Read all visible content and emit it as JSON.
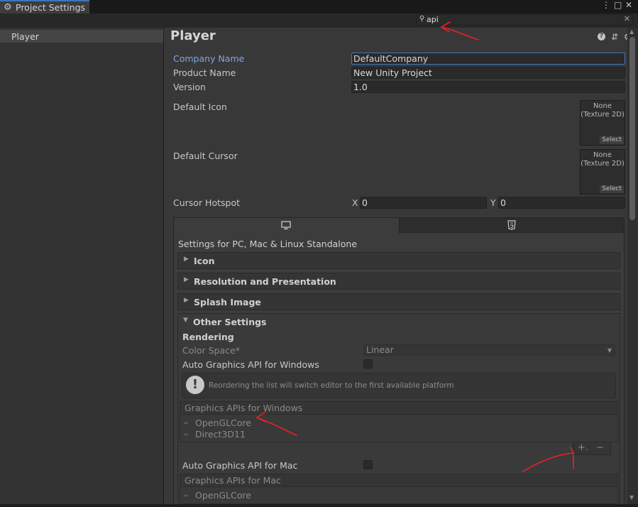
{
  "window": {
    "tab_title": "Project Settings",
    "menu_glyph": "⋮",
    "maximize_glyph": "□",
    "close_glyph": "✕"
  },
  "search": {
    "value": "api",
    "clear_glyph": "✕"
  },
  "sidebar": {
    "items": [
      {
        "label": "Player"
      }
    ]
  },
  "main": {
    "title": "Player",
    "help_glyph": "?",
    "preset_glyph": "⇵",
    "settings_glyph": "⚙"
  },
  "fields": {
    "company_name": {
      "label": "Company Name",
      "value": "DefaultCompany"
    },
    "product_name": {
      "label": "Product Name",
      "value": "New Unity Project"
    },
    "version": {
      "label": "Version",
      "value": "1.0"
    },
    "default_icon": {
      "label": "Default Icon",
      "slot_text": "None\n(Texture 2D)",
      "select_label": "Select"
    },
    "default_cursor": {
      "label": "Default Cursor",
      "slot_text": "None\n(Texture 2D)",
      "select_label": "Select"
    },
    "cursor_hotspot": {
      "label": "Cursor Hotspot",
      "x_label": "X",
      "x_value": "0",
      "y_label": "Y",
      "y_value": "0"
    }
  },
  "platform": {
    "settings_for": "Settings for PC, Mac & Linux Standalone",
    "foldouts": [
      {
        "label": "Icon",
        "arrow": "▶"
      },
      {
        "label": "Resolution and Presentation",
        "arrow": "▶"
      },
      {
        "label": "Splash Image",
        "arrow": "▶"
      },
      {
        "label": "Other Settings",
        "arrow": "▼"
      }
    ],
    "other_settings": {
      "rendering_header": "Rendering",
      "color_space": {
        "label": "Color Space*",
        "value": "Linear",
        "arrow": "▼"
      },
      "auto_graphics_windows": {
        "label": "Auto Graphics API  for Windows"
      },
      "help_text": "Reordering the list will switch editor to the first available platform",
      "warn_glyph": "!",
      "graphics_apis_windows": {
        "header": "Graphics APIs for Windows",
        "items": [
          "OpenGLCore",
          "Direct3D11"
        ]
      },
      "list_add_glyph": "+.",
      "list_remove_glyph": "−",
      "auto_graphics_mac": {
        "label": "Auto Graphics API  for Mac"
      },
      "graphics_apis_mac": {
        "header": "Graphics APIs for Mac",
        "items": [
          "OpenGLCore"
        ]
      }
    }
  },
  "handle_glyph": "═",
  "scroll": {
    "up_glyph": "▲",
    "down_glyph": "▼"
  },
  "annotation_color": "#e8202a"
}
